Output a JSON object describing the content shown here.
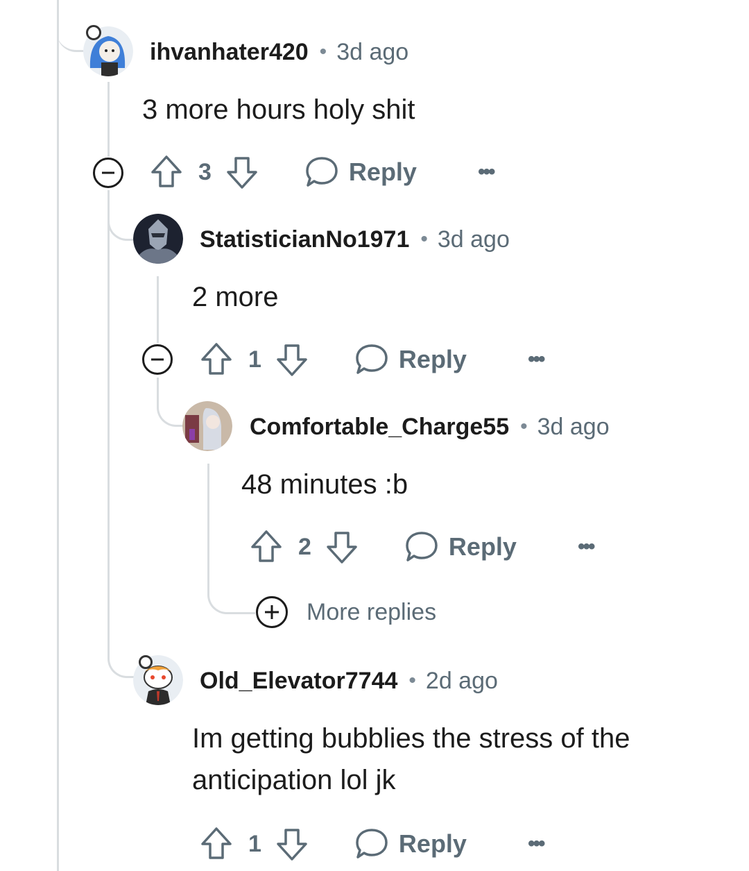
{
  "colors": {
    "line": "#d9dde0",
    "muted": "#5b6b76",
    "text": "#1c1c1c"
  },
  "comments": [
    {
      "username": "ihvanhater420",
      "time": "3d ago",
      "body": [
        "3 more hours holy shit"
      ],
      "votes": "3",
      "reply": "Reply",
      "avatar": "avatar-blue-hair"
    },
    {
      "username": "StatisticianNo1971",
      "time": "3d ago",
      "body": [
        "2 more"
      ],
      "votes": "1",
      "reply": "Reply",
      "avatar": "avatar-armored-knight"
    },
    {
      "username": "Comfortable_Charge55",
      "time": "3d ago",
      "body": [
        "48 minutes :b"
      ],
      "votes": "2",
      "reply": "Reply",
      "avatar": "avatar-anime-girl"
    },
    {
      "username": "Old_Elevator7744",
      "time": "2d ago",
      "body": [
        "Im getting bubblies the stress of the",
        "anticipation lol jk"
      ],
      "votes": "1",
      "reply": "Reply",
      "avatar": "avatar-snoo-suit"
    }
  ],
  "more_replies": "More replies",
  "separator": "•",
  "overflow": "•••"
}
